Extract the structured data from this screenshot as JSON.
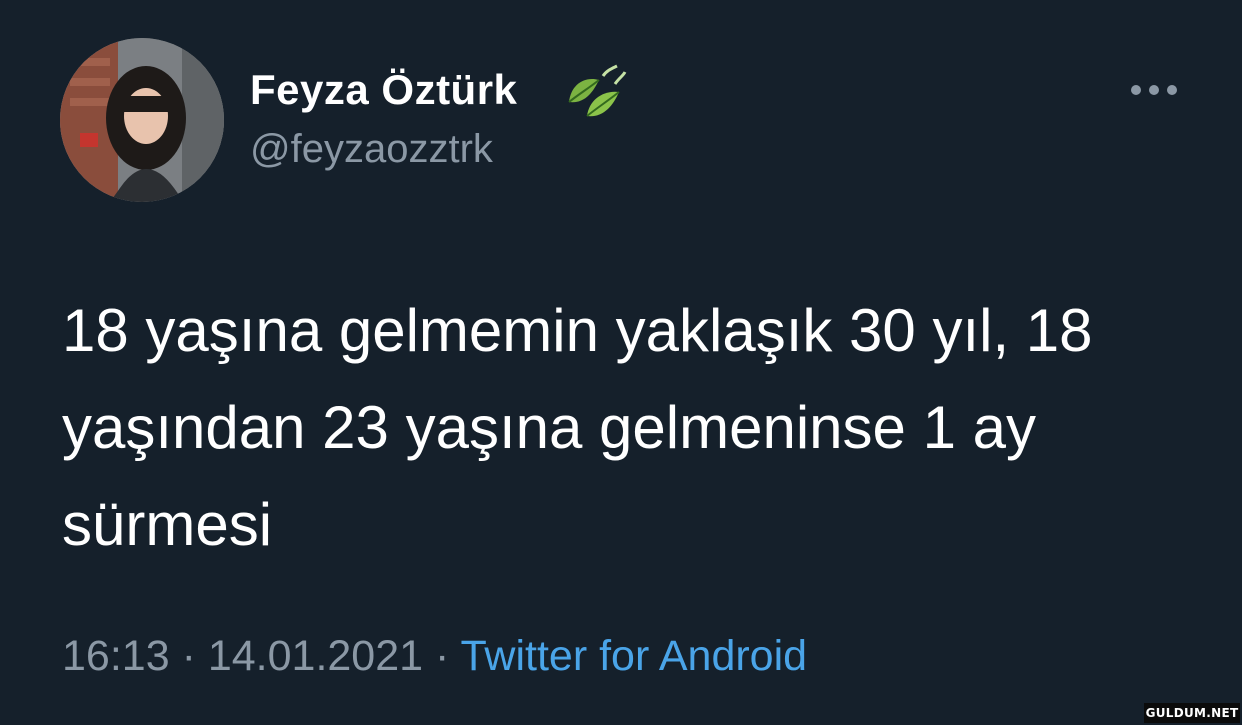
{
  "tweet": {
    "author": {
      "display_name": "Feyza Öztürk",
      "handle": "@feyzaozztrk",
      "name_emoji_icon": "herb-leaves-icon",
      "avatar_icon": "profile-photo"
    },
    "text": "18 yaşına gelmemin yaklaşık 30 yıl, 18 yaşından 23 yaşına gelmeninse 1 ay sürmesi",
    "time": "16:13",
    "date": "14.01.2021",
    "separator": "·",
    "source": "Twitter for Android",
    "more_icon": "more-options-icon"
  },
  "watermark": {
    "text": "GULDUM.NET"
  },
  "colors": {
    "background": "#15202b",
    "primary_text": "#ffffff",
    "secondary_text": "#8b98a5",
    "link": "#4aa4e8"
  }
}
